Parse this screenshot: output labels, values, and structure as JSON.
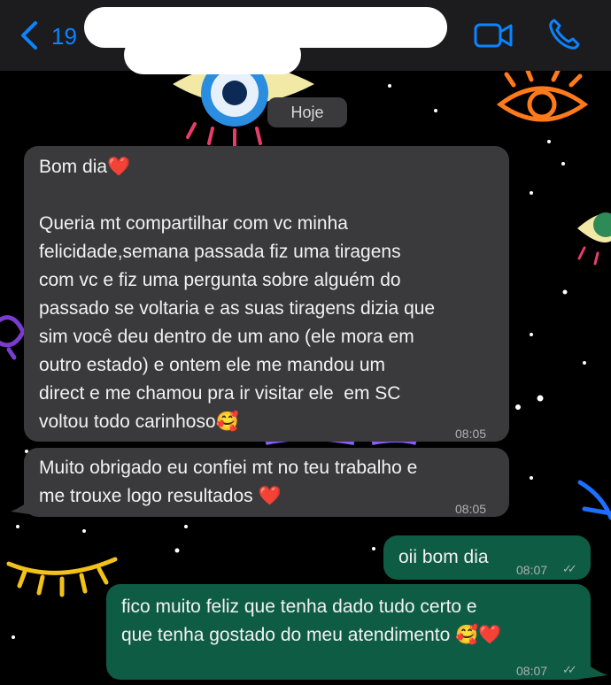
{
  "header": {
    "contact_name": "19",
    "colors": {
      "accent": "#0a84ff",
      "bar": "#1c1c1e"
    }
  },
  "date_separator": "Hoje",
  "messages": [
    {
      "direction": "incoming",
      "text": "Bom dia❤️\n\nQueria mt compartilhar com vc minha\nfelicidade,semana passada fiz uma tiragens\ncom vc e fiz uma pergunta sobre alguém do\npassado se voltaria e as suas tiragens dizia que\nsim você deu dentro de um ano (ele mora em\noutro estado) e ontem ele me mandou um\ndirect e me chamou pra ir visitar ele  em SC\nvoltou todo carinhoso🥰",
      "time": "08:05"
    },
    {
      "direction": "incoming",
      "text": "Muito obrigado eu confiei mt no teu trabalho e\nme trouxe logo resultados ❤️",
      "time": "08:05"
    },
    {
      "direction": "outgoing",
      "text": "oii bom dia",
      "time": "08:07",
      "status_icon": "double-check"
    },
    {
      "direction": "outgoing",
      "text": "fico muito feliz que tenha dado tudo certo e\nque tenha gostado do meu atendimento 🥰❤️",
      "time": "08:07",
      "status_icon": "double-check"
    }
  ],
  "colors": {
    "incoming_bubble": "#3a3a3c",
    "outgoing_bubble": "#0f5c45",
    "background": "#000000"
  },
  "icons": [
    "chevron-left-icon",
    "video-call-icon",
    "phone-call-icon"
  ]
}
